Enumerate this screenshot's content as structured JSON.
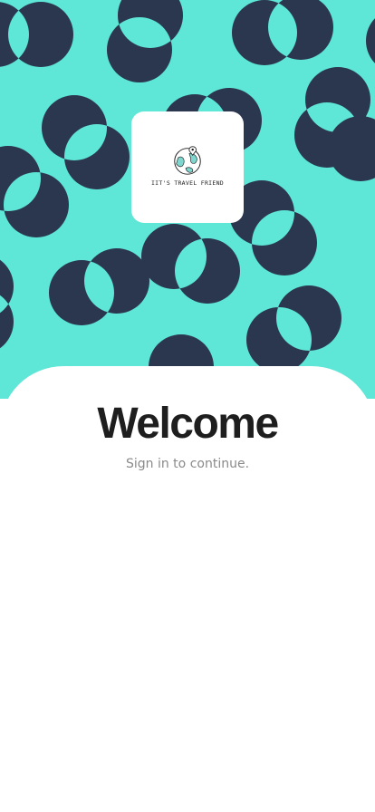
{
  "colors": {
    "hero_background": "#5ee6d6",
    "circle_fill": "#2b374f",
    "title_text": "#1e1e1e",
    "subtitle_text": "#8a8a8a",
    "card_background": "#ffffff"
  },
  "logo": {
    "icon": "globe-traveler-icon",
    "text": "IIT'S TRAVEL FRIEND"
  },
  "welcome": {
    "title": "Welcome",
    "subtitle": "Sign in to continue."
  }
}
